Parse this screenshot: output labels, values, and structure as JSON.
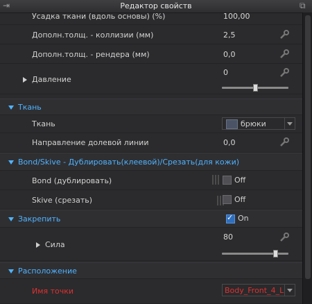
{
  "window": {
    "title": "Редактор свойств"
  },
  "rows": {
    "shrink": {
      "label": "Усадка ткани (вдоль основы) (%)",
      "value": "100,00"
    },
    "collision": {
      "label": "Дополн.толщ. - коллизии (мм)",
      "value": "2,5"
    },
    "render": {
      "label": "Дополн.толщ. - рендера (мм)",
      "value": "0,0"
    },
    "pressure": {
      "label": "Давление",
      "value": "0",
      "slider_fraction": 0.5
    },
    "fabric_section": {
      "label": "Ткань"
    },
    "fabric": {
      "label": "Ткань",
      "value": "брюки"
    },
    "grain": {
      "label": "Направление долевой линии",
      "value": "0,0"
    },
    "bond_section": {
      "label": "Bond/Skive - Дублировать(клеевой)/Срезать(для кожи)"
    },
    "bond": {
      "label": "Bond (дублировать)",
      "value": "Off"
    },
    "skive": {
      "label": "Skive (срезать)",
      "value": "Off"
    },
    "pin": {
      "label": "Закрепить",
      "value": "On"
    },
    "strength": {
      "label": "Сила",
      "value": "80",
      "slider_fraction": 0.8
    },
    "placement_section": {
      "label": "Расположение"
    },
    "point": {
      "label": "Имя точки",
      "value": "Body_Front_4_L"
    }
  },
  "colors": {
    "section_text": "#4fb3ff",
    "highlight_text": "#e03030",
    "checkbox_on": "#2f6fbf"
  },
  "icons": [
    "wrench-icon",
    "expand-arrow-icon",
    "collapse-arrow-icon",
    "dropdown-caret-icon",
    "checkmark-icon"
  ]
}
